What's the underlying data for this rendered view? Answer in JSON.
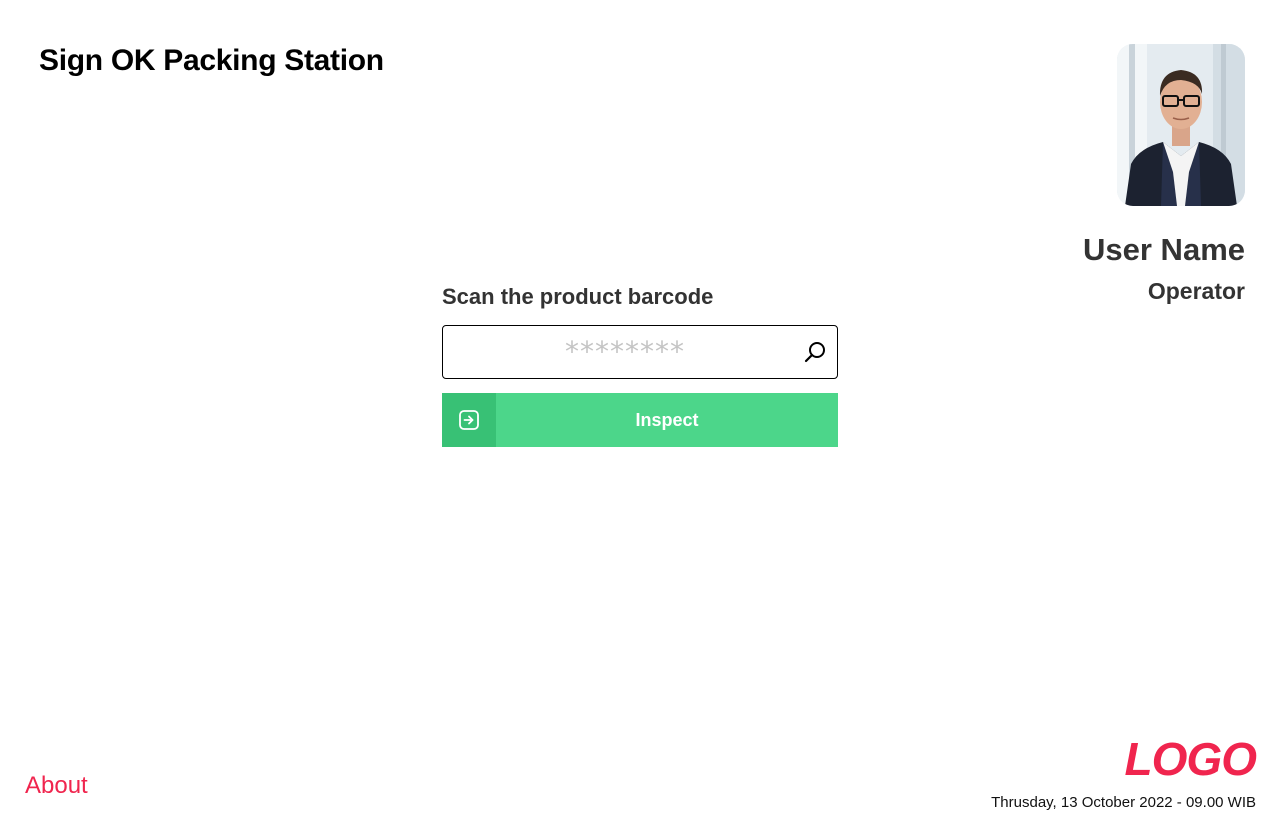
{
  "header": {
    "title": "Sign OK Packing Station"
  },
  "user": {
    "name": "User Name",
    "role": "Operator",
    "avatar_icon": "user-photo"
  },
  "scan": {
    "label": "Scan the product barcode",
    "placeholder": "********",
    "value": "",
    "search_icon": "search-icon"
  },
  "inspect_button": {
    "label": "Inspect",
    "icon": "enter-arrow-icon"
  },
  "footer": {
    "about_label": "About",
    "logo_text": "LOGO",
    "datetime": "Thrusday, 13 October 2022 - 09.00 WIB"
  },
  "colors": {
    "accent": "#f0254e",
    "button_green": "#4cd68a",
    "button_icon_green": "#38c175",
    "text_dark": "#333333"
  }
}
